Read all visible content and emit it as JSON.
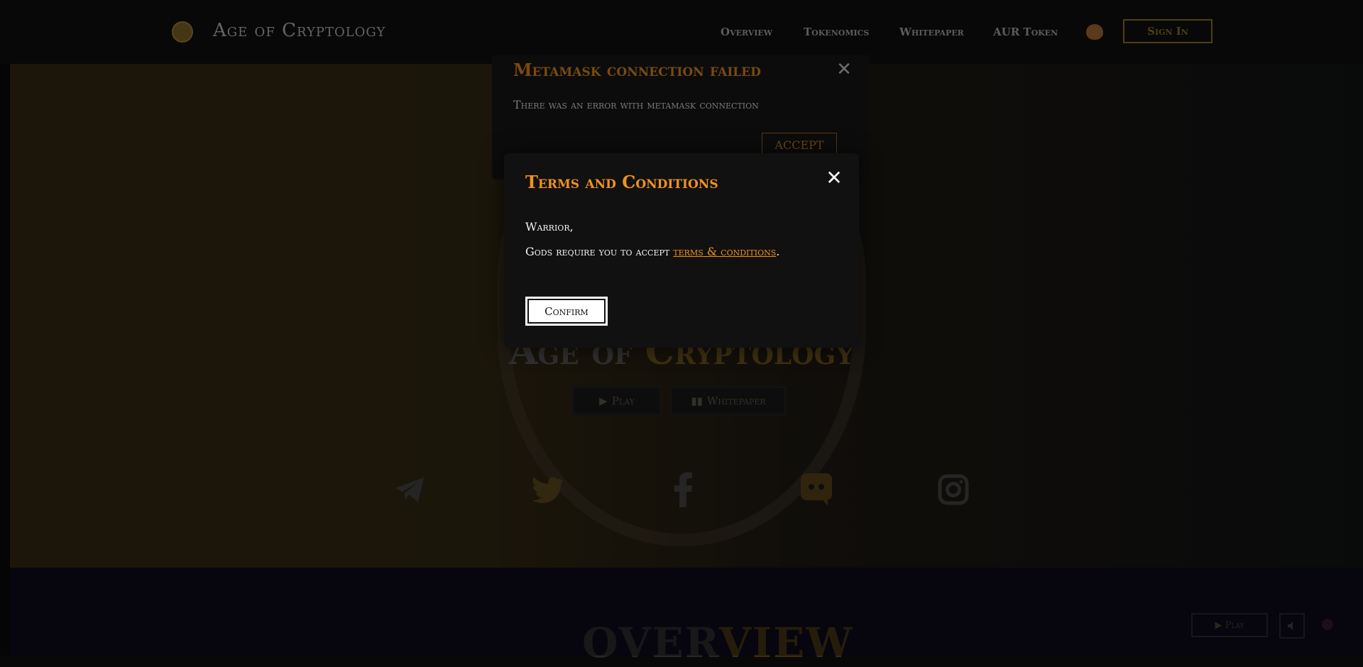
{
  "header": {
    "brand": "Age of Cryptology",
    "nav": [
      "Overview",
      "Tokenomics",
      "Whitepaper",
      "AUR Token"
    ],
    "sign_in": "Sign In",
    "icons": [
      "logo-icon",
      "pancakeswap-icon"
    ]
  },
  "hero": {
    "title_part1": "Age of",
    "title_part2": "Cryptology",
    "play_label": "Play",
    "whitepaper_label": "Whitepaper",
    "socials": [
      "telegram-icon",
      "twitter-icon",
      "facebook-icon",
      "discord-icon",
      "instagram-icon"
    ]
  },
  "overview": {
    "title_part1": "OVER",
    "title_part2": "VIEW"
  },
  "floating": {
    "play_label": "Play",
    "sound_icon": "speaker-mute-icon"
  },
  "metamask_modal": {
    "title": "Metamask connection failed",
    "message": "There was an error with metamask connection",
    "accept_label": "ACCEPT",
    "close_glyph": "✕"
  },
  "terms_modal": {
    "title": "Terms and Conditions",
    "greeting": "Warrior,",
    "body_prefix": "Gods require you to accept ",
    "link_text": "terms & conditions",
    "body_suffix": ".",
    "confirm_label": "Confirm",
    "close_glyph": "✕"
  },
  "colors": {
    "accent": "#f0921e",
    "modal_bg": "#111111",
    "text": "#f4f4f4"
  }
}
